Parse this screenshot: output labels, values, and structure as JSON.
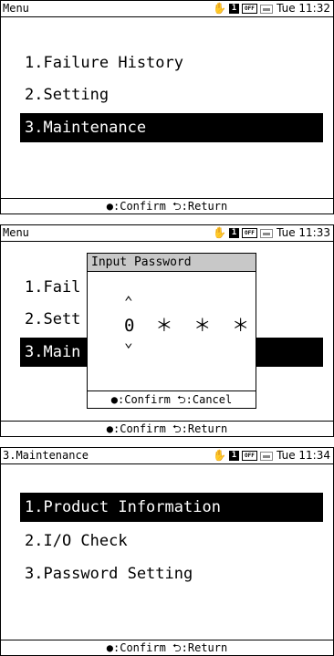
{
  "screen1": {
    "title": "Menu",
    "time": "Tue 11:32",
    "items": [
      "1.Failure History",
      "2.Setting",
      "3.Maintenance"
    ],
    "footer": "●:Confirm ⮌:Return"
  },
  "screen2": {
    "title": "Menu",
    "time": "Tue 11:33",
    "items": [
      "1.Fail",
      "2.Sett",
      "3.Main"
    ],
    "dialog": {
      "title": "Input Password",
      "digits": "0  ＊  ＊  ＊",
      "up": "⌃",
      "down": "⌄",
      "footer": "●:Confirm ⮌:Cancel"
    },
    "footer": "●:Confirm ⮌:Return"
  },
  "screen3": {
    "title": "3.Maintenance",
    "time": "Tue 11:34",
    "items": [
      "1.Product Information",
      "2.I/O Check",
      "3.Password Setting"
    ],
    "footer": "●:Confirm ⮌:Return"
  },
  "icons": {
    "hand": "✋",
    "one": "1",
    "off": "OFF"
  }
}
